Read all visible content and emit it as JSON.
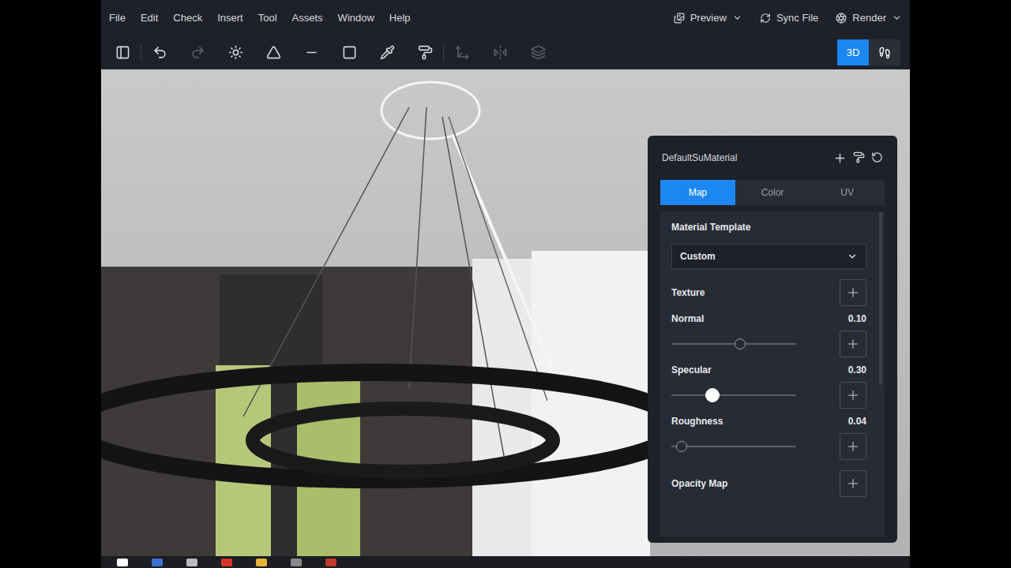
{
  "menu": [
    "File",
    "Edit",
    "Check",
    "Insert",
    "Tool",
    "Assets",
    "Window",
    "Help"
  ],
  "top_actions": [
    {
      "label": "Preview",
      "dropdown": true
    },
    {
      "label": "Sync File",
      "dropdown": false
    },
    {
      "label": "Render",
      "dropdown": true
    }
  ],
  "tools": [
    {
      "disabled": false
    },
    {
      "disabled": false
    },
    {
      "disabled": true
    },
    {
      "disabled": false
    },
    {
      "disabled": false
    },
    {
      "disabled": false
    },
    {
      "disabled": false
    },
    {
      "disabled": false
    },
    {
      "disabled": false
    },
    {
      "disabled": true
    },
    {
      "disabled": true
    },
    {
      "disabled": true
    }
  ],
  "view_modes": [
    {
      "label": "3D",
      "selected": true
    },
    {
      "label": "",
      "selected": false
    }
  ],
  "panel": {
    "title": "DefaultSuMaterial",
    "tabs": [
      {
        "label": "Map",
        "selected": true
      },
      {
        "label": "Color",
        "selected": false
      },
      {
        "label": "UV",
        "selected": false
      }
    ],
    "template": {
      "label": "Material Template",
      "value": "Custom"
    },
    "rows": [
      {
        "kind": "map",
        "label": "Texture"
      },
      {
        "kind": "slider",
        "label": "Normal",
        "value": "0.10",
        "level": 0.55,
        "active": false
      },
      {
        "kind": "slider",
        "label": "Specular",
        "value": "0.30",
        "level": 0.33,
        "active": true
      },
      {
        "kind": "slider",
        "label": "Roughness",
        "value": "0.04",
        "level": 0.08,
        "active": false
      },
      {
        "kind": "map",
        "label": "Opacity Map"
      }
    ]
  }
}
